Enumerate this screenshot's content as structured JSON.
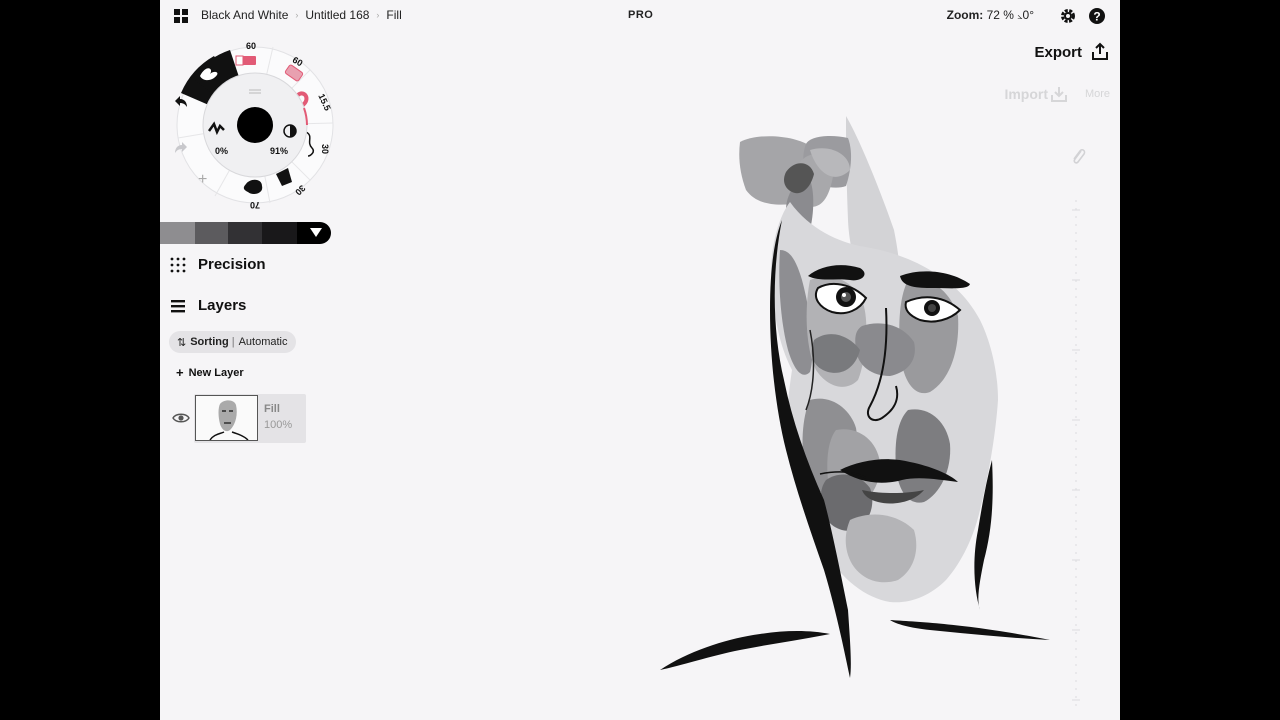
{
  "breadcrumb": [
    "Black And White",
    "Untitled 168",
    "Fill"
  ],
  "badge": "PRO",
  "zoom": {
    "label": "Zoom:",
    "value": "72 %",
    "rotation": "0°"
  },
  "header_icons": [
    "grid-icon",
    "gear-icon",
    "help-icon"
  ],
  "actions": {
    "export": "Export",
    "import": "Import",
    "more": "More"
  },
  "tool_wheel": {
    "brush_size_top": "60",
    "eraser_size": "60",
    "pen_size": "15.5",
    "pencil_size": "30",
    "fill_size": "30",
    "airbrush_size": "70",
    "smoothing": "0%",
    "opacity": "91%"
  },
  "palette_colors": [
    "#8e8d90",
    "#5c5b5e",
    "#323134",
    "#19181a",
    "#000000"
  ],
  "precision": {
    "label": "Precision"
  },
  "layers": {
    "title": "Layers",
    "sorting_label": "Sorting",
    "sorting_value": "Automatic",
    "new_layer": "New Layer",
    "items": [
      {
        "name": "Fill",
        "opacity": "100%"
      }
    ]
  },
  "colors": {
    "accent": "#e25b76",
    "ink": "#111111",
    "canvas": "#f6f5f7"
  }
}
